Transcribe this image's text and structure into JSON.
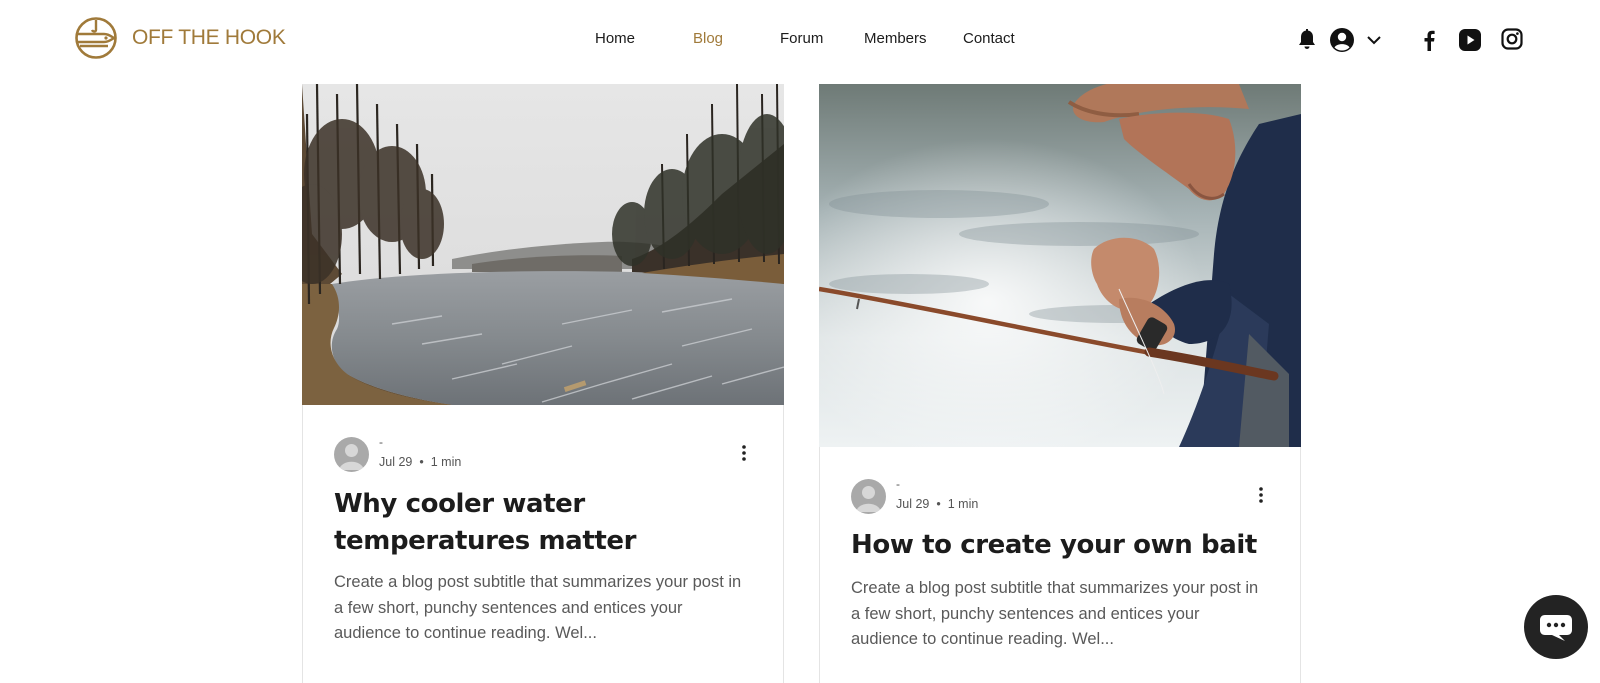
{
  "brand": {
    "name": "OFF THE HOOK",
    "accent": "#a07a3a"
  },
  "nav": {
    "items": [
      {
        "label": "Home",
        "active": false
      },
      {
        "label": "Blog",
        "active": true
      },
      {
        "label": "Forum",
        "active": false
      },
      {
        "label": "Members",
        "active": false
      },
      {
        "label": "Contact",
        "active": false
      }
    ]
  },
  "header_icons": [
    "bell-icon",
    "user-icon",
    "chevron-down-icon",
    "facebook-icon",
    "youtube-icon",
    "instagram-icon"
  ],
  "posts": [
    {
      "image": "frozen-lake-photo",
      "author": "-",
      "date": "Jul 29",
      "read_time": "1 min",
      "title": "Why cooler water temperatures matter",
      "excerpt": "Create a blog post subtitle that summarizes your post in a few short, punchy sentences and entices your audience to continue reading. Wel..."
    },
    {
      "image": "fisherman-tying-line-photo",
      "author": "-",
      "date": "Jul 29",
      "read_time": "1 min",
      "title": "How to create your own bait",
      "excerpt": "Create a blog post subtitle that summarizes your post in a few short, punchy sentences and entices your audience to continue reading. Wel..."
    }
  ],
  "chat": {
    "icon": "chat-bubble-icon"
  }
}
